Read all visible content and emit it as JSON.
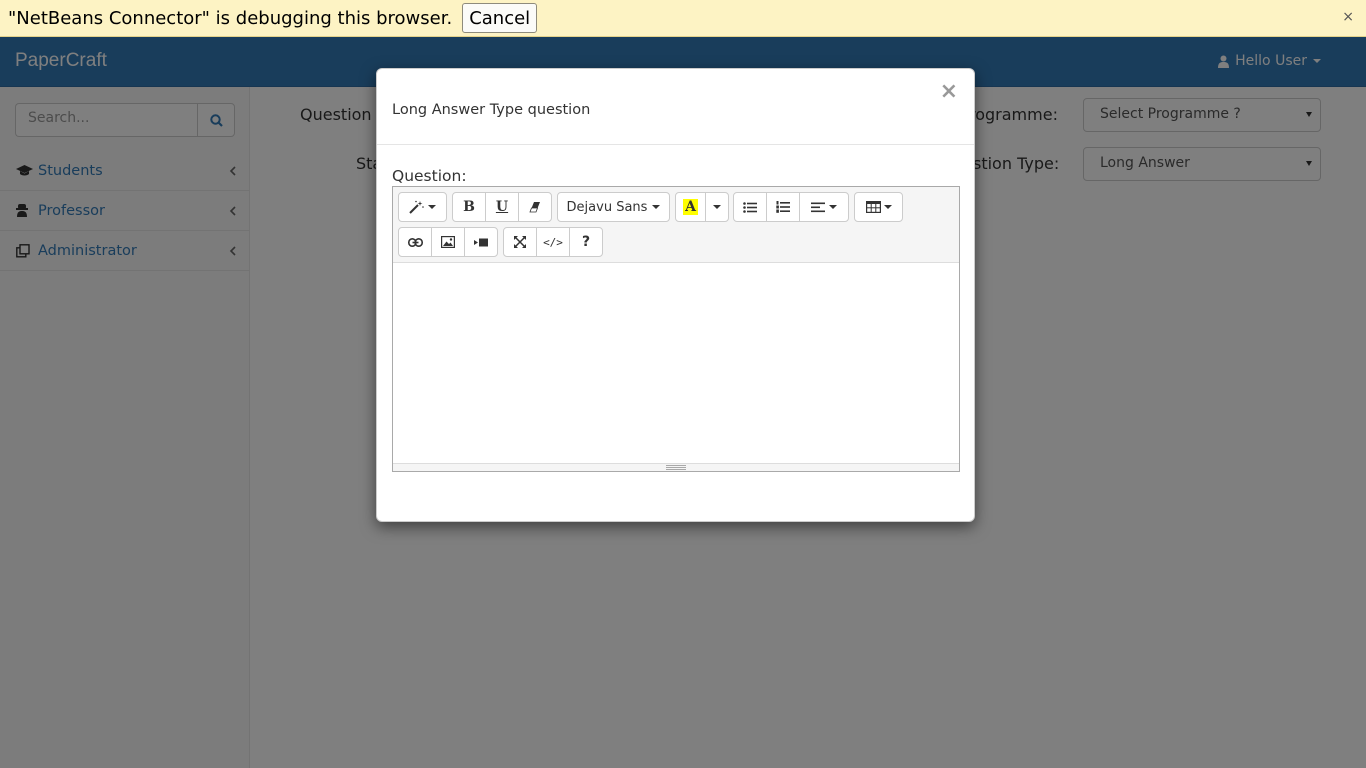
{
  "debug_bar": {
    "message": "\"NetBeans Connector\" is debugging this browser.",
    "cancel_label": "Cancel",
    "close_glyph": "×"
  },
  "navbar": {
    "brand": "PaperCraft",
    "user_label": "Hello User",
    "user_icon": "user-icon"
  },
  "sidebar": {
    "search_placeholder": "Search...",
    "items": [
      {
        "label": "Students",
        "icon": "graduation-cap-icon"
      },
      {
        "label": "Professor",
        "icon": "user-secret-icon"
      },
      {
        "label": "Administrator",
        "icon": "clone-icon"
      }
    ]
  },
  "main": {
    "question_category_label": "Question C",
    "status_label": "Sta",
    "programme_label": "rogramme:",
    "question_type_label": "stion Type:",
    "programme_select": "Select Programme ?",
    "question_type_select": "Long Answer"
  },
  "modal": {
    "title": "Long Answer Type question",
    "close_glyph": "×",
    "question_label": "Question:",
    "toolbar": {
      "font_name": "Dejavu Sans",
      "bold": "B",
      "underline": "U",
      "help": "?",
      "highlight_letter": "A",
      "code": "</>"
    },
    "editor_content": ""
  },
  "colors": {
    "navbar": "#337ab7",
    "debug_bar": "#fdf3c4",
    "link": "#337ab7",
    "highlight": "#ffff00"
  }
}
